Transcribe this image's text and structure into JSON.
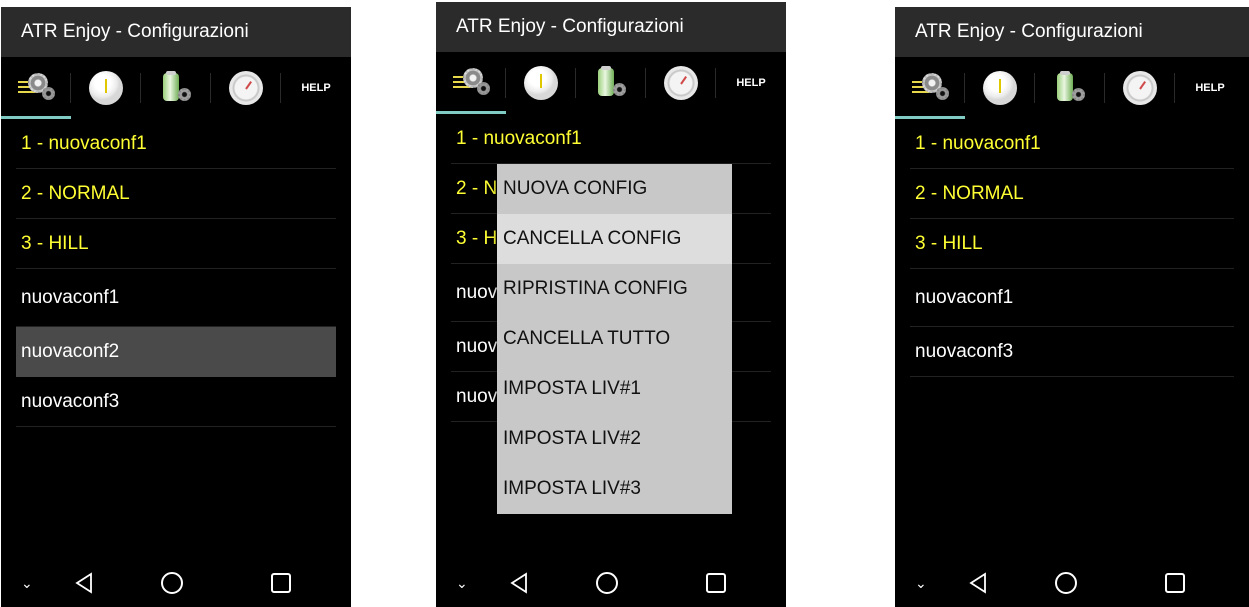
{
  "app_title": "ATR Enjoy - Configurazioni",
  "tabs": {
    "config_icon": "config-gear-icon",
    "level_icon": "level-icon",
    "battery_icon": "battery-gear-icon",
    "gauge_icon": "gauge-icon",
    "help_label": "HELP"
  },
  "colors": {
    "accent": "#80cbc4",
    "preset_text": "#ffff33",
    "user_text": "#ffffff",
    "selected_row": "#4a4a4a",
    "menu_bg": "#c8c8c8"
  },
  "screen1": {
    "presets": [
      "1 - nuovaconf1",
      "2 - NORMAL",
      "3 - HILL"
    ],
    "user_configs": [
      "nuovaconf1",
      "nuovaconf2",
      "nuovaconf3"
    ],
    "selected": "nuovaconf2"
  },
  "screen2": {
    "presets": [
      "1 - nuovaconf1",
      "2 - N",
      "3 - H"
    ],
    "user_configs": [
      "nuov",
      "nuov",
      "nuov"
    ],
    "menu": [
      "NUOVA CONFIG",
      "CANCELLA CONFIG",
      "RIPRISTINA CONFIG",
      "CANCELLA TUTTO",
      "IMPOSTA LIV#1",
      "IMPOSTA LIV#2",
      "IMPOSTA LIV#3"
    ],
    "menu_highlighted": "CANCELLA CONFIG"
  },
  "screen3": {
    "presets": [
      "1 - nuovaconf1",
      "2 - NORMAL",
      "3 - HILL"
    ],
    "user_configs": [
      "nuovaconf1",
      "nuovaconf3"
    ]
  },
  "navbar": {
    "chevron": "chevron-down-icon",
    "back": "back-icon",
    "home": "home-icon",
    "recents": "recents-icon"
  }
}
